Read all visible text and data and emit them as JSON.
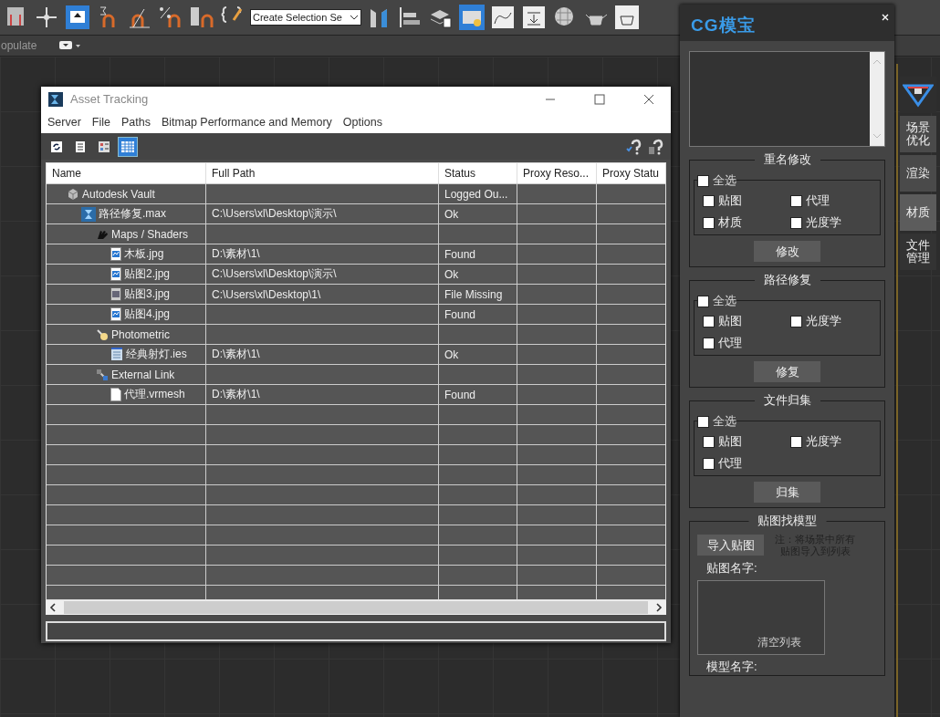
{
  "toolbar": {
    "selection_set": {
      "value": "Create Selection Se"
    }
  },
  "ribbon": {
    "populate_label": "opulate"
  },
  "asset_window": {
    "title": "Asset Tracking",
    "menu": [
      "Server",
      "File",
      "Paths",
      "Bitmap Performance and Memory",
      "Options"
    ],
    "view_buttons": [
      {
        "kind": "refresh",
        "selected": false
      },
      {
        "kind": "list",
        "selected": false
      },
      {
        "kind": "thumbs",
        "selected": false
      },
      {
        "kind": "table",
        "selected": true
      }
    ],
    "columns": [
      "Name",
      "Full Path",
      "Status",
      "Proxy Reso...",
      "Proxy Statu"
    ],
    "rows": [
      {
        "kind": "vault",
        "name": "Autodesk Vault",
        "status": "Logged Ou...",
        "children": [
          {
            "kind": "max",
            "name": "路径修复.max",
            "path": "C:\\Users\\xl\\Desktop\\演示\\",
            "status": "Ok",
            "children": [
              {
                "kind": "maps",
                "name": "Maps / Shaders",
                "children": [
                  {
                    "kind": "image",
                    "name": "木板.jpg",
                    "path": "D:\\素材\\1\\",
                    "status": "Found"
                  },
                  {
                    "kind": "image",
                    "name": "贴图2.jpg",
                    "path": "C:\\Users\\xl\\Desktop\\演示\\",
                    "status": "Ok"
                  },
                  {
                    "kind": "image-missing",
                    "name": "贴图3.jpg",
                    "path": "C:\\Users\\xl\\Desktop\\1\\",
                    "status": "File Missing"
                  },
                  {
                    "kind": "image",
                    "name": "贴图4.jpg",
                    "status": "Found"
                  }
                ]
              },
              {
                "kind": "photometric",
                "name": "Photometric",
                "children": [
                  {
                    "kind": "ies",
                    "name": "经典射灯.ies",
                    "path": "D:\\素材\\1\\",
                    "status": "Ok"
                  }
                ]
              },
              {
                "kind": "external",
                "name": "External Link",
                "children": [
                  {
                    "kind": "mesh",
                    "name": "代理.vrmesh",
                    "path": "D:\\素材\\1\\",
                    "status": "Found"
                  }
                ]
              }
            ]
          }
        ]
      }
    ]
  },
  "panel": {
    "logo": "CG模宝",
    "sections": [
      {
        "title": "重名修改",
        "select_all": {
          "label": "全选",
          "checked": false
        },
        "options": [
          {
            "label": "贴图",
            "checked": false
          },
          {
            "label": "代理",
            "checked": false
          },
          {
            "label": "材质",
            "checked": false
          },
          {
            "label": "光度学",
            "checked": false
          }
        ],
        "button": "修改"
      },
      {
        "title": "路径修复",
        "select_all": {
          "label": "全选",
          "checked": false
        },
        "options": [
          {
            "label": "贴图",
            "checked": false
          },
          {
            "label": "光度学",
            "checked": false
          },
          {
            "label": "代理",
            "checked": false
          }
        ],
        "button": "修复"
      },
      {
        "title": "文件归集",
        "select_all": {
          "label": "全选",
          "checked": false
        },
        "options": [
          {
            "label": "贴图",
            "checked": false
          },
          {
            "label": "光度学",
            "checked": false
          },
          {
            "label": "代理",
            "checked": false
          }
        ],
        "button": "归集"
      }
    ],
    "find_model": {
      "title": "贴图找模型",
      "import_button": "导入贴图",
      "note": "注：将场景中所有贴图导入到列表",
      "map_name_label": "贴图名字:",
      "clear_button": "清空列表",
      "model_name_label": "模型名字:"
    }
  },
  "side_tabs": [
    {
      "label": "场景优化",
      "selected": false
    },
    {
      "label": "渲染",
      "selected": false
    },
    {
      "label": "材质",
      "selected": true
    },
    {
      "label": "文件管理",
      "selected": false
    }
  ]
}
